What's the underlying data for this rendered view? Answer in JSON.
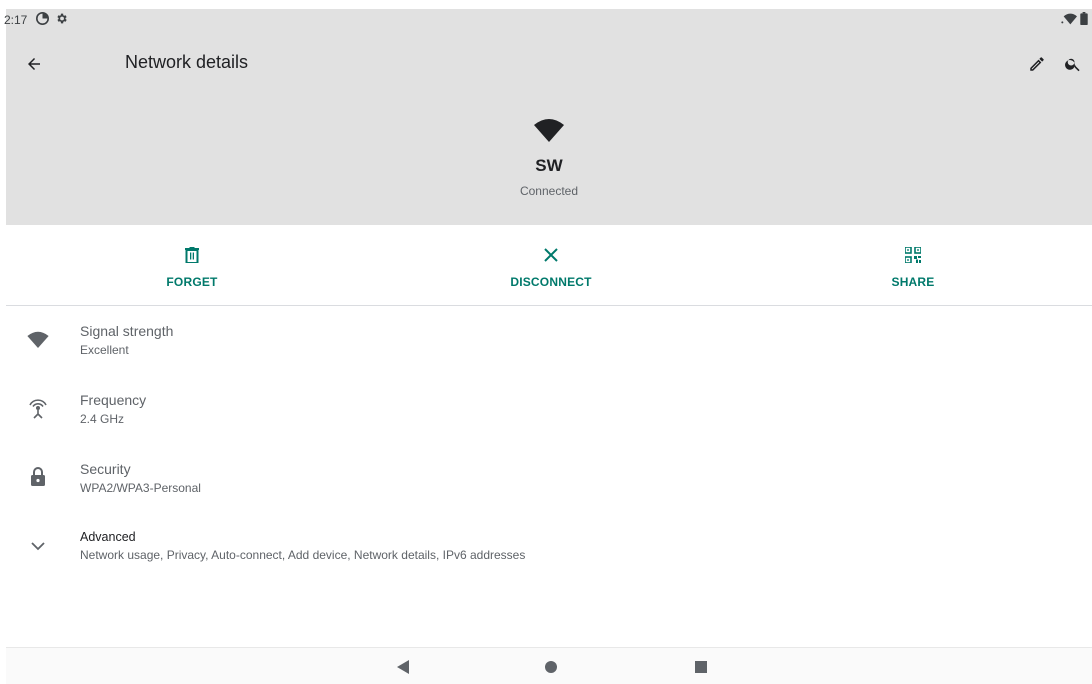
{
  "status_bar": {
    "time": "2:17",
    "left_icons": [
      "data-saver-icon",
      "settings-icon"
    ],
    "right_icons": [
      "wifi-icon",
      "battery-icon"
    ]
  },
  "app_bar": {
    "title": "Network details",
    "back_icon": "arrow-back-icon",
    "edit_icon": "pencil-icon",
    "search_icon": "search-icon"
  },
  "network": {
    "name": "SW",
    "status": "Connected"
  },
  "actions": [
    {
      "label": "FORGET",
      "icon": "trash-icon"
    },
    {
      "label": "DISCONNECT",
      "icon": "close-icon"
    },
    {
      "label": "SHARE",
      "icon": "qr-code-icon"
    }
  ],
  "details": [
    {
      "title": "Signal strength",
      "value": "Excellent",
      "icon": "wifi-signal-icon"
    },
    {
      "title": "Frequency",
      "value": "2.4 GHz",
      "icon": "antenna-icon"
    },
    {
      "title": "Security",
      "value": "WPA2/WPA3-Personal",
      "icon": "lock-icon"
    },
    {
      "title": "Advanced",
      "value": "Network usage, Privacy, Auto-connect, Add device, Network details, IPv6 addresses",
      "icon": "chevron-down-icon"
    }
  ],
  "colors": {
    "accent": "#00796b",
    "header_bg": "#e1e1e1",
    "icon_gray": "#5f6368"
  },
  "nav_bar": [
    "back-triangle-icon",
    "home-circle-icon",
    "recents-square-icon"
  ]
}
